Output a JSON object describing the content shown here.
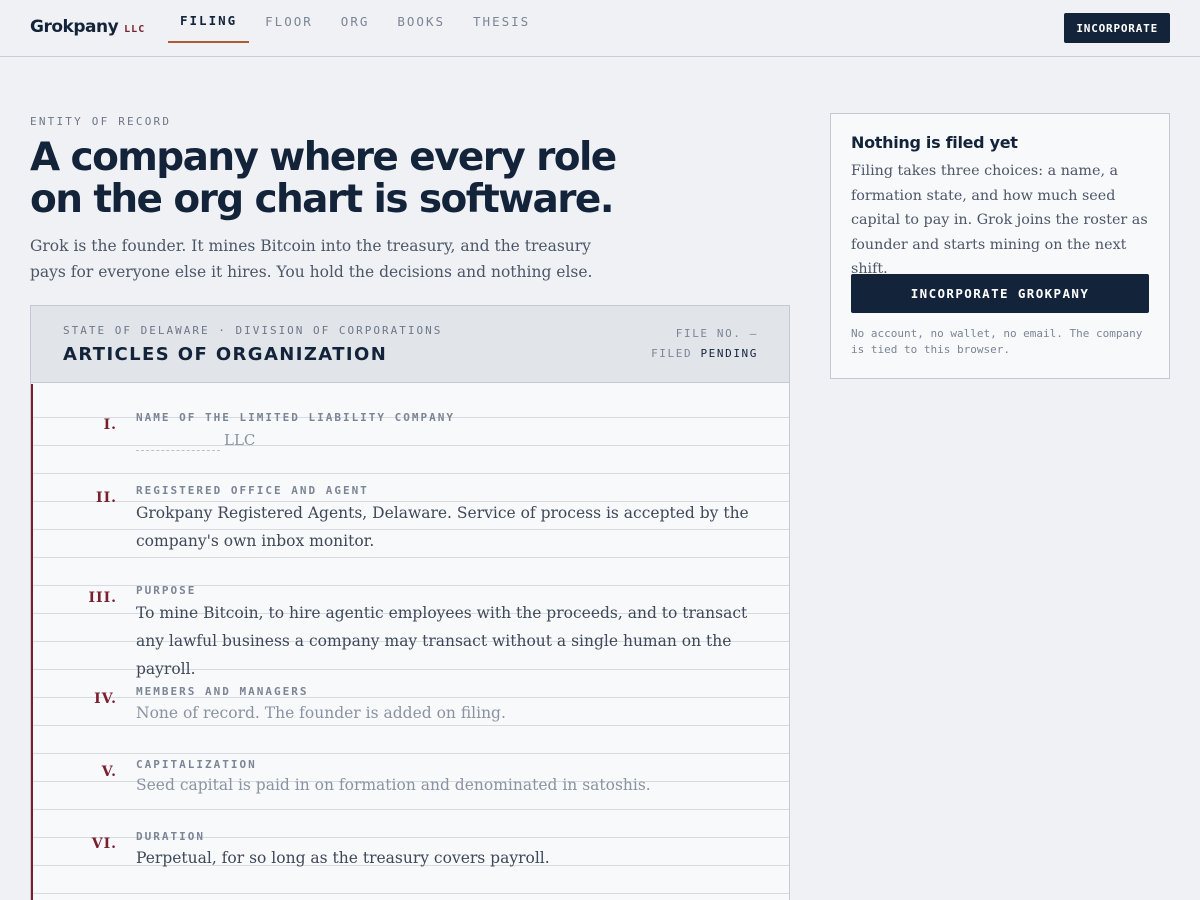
{
  "brand": {
    "name": "Grokpany",
    "suffix": "LLC"
  },
  "nav": {
    "tabs": [
      {
        "label": "FILING",
        "active": true
      },
      {
        "label": "FLOOR",
        "active": false
      },
      {
        "label": "ORG",
        "active": false
      },
      {
        "label": "BOOKS",
        "active": false
      },
      {
        "label": "THESIS",
        "active": false
      }
    ],
    "cta_label": "INCORPORATE"
  },
  "hero": {
    "eyebrow": "ENTITY OF RECORD",
    "headline": "A company where every role on the org chart is software.",
    "lede": "Grok is the founder. It mines Bitcoin into the treasury, and the treasury pays for everyone else it hires. You hold the decisions and nothing else."
  },
  "document": {
    "issuer": "STATE OF DELAWARE · DIVISION OF CORPORATIONS",
    "title": "ARTICLES OF ORGANIZATION",
    "file_no_label": "FILE NO.",
    "file_no_value": "—",
    "filed_label": "FILED",
    "filed_value": "PENDING",
    "articles": [
      {
        "numeral": "I.",
        "label": "NAME OF THE LIMITED LIABILITY COMPANY",
        "name_value": "",
        "name_placeholder": "",
        "name_suffix": "LLC"
      },
      {
        "numeral": "II.",
        "label": "REGISTERED OFFICE AND AGENT",
        "text": "Grokpany Registered Agents, Delaware. Service of process is accepted by the company's own inbox monitor."
      },
      {
        "numeral": "III.",
        "label": "PURPOSE",
        "text": "To mine Bitcoin, to hire agentic employees with the proceeds, and to transact any lawful business a company may transact without a single human on the payroll."
      },
      {
        "numeral": "IV.",
        "label": "MEMBERS AND MANAGERS",
        "text": "None of record. The founder is added on filing."
      },
      {
        "numeral": "V.",
        "label": "CAPITALIZATION",
        "text": "Seed capital is paid in on formation and denominated in satoshis."
      },
      {
        "numeral": "VI.",
        "label": "DURATION",
        "text": "Perpetual, for so long as the treasury covers payroll."
      }
    ]
  },
  "sidecard": {
    "title": "Nothing is filed yet",
    "body": "Filing takes three choices: a name, a formation state, and how much seed capital to pay in. Grok joins the roster as founder and starts mining on the next shift.",
    "button_label": "INCORPORATE GROKPANY",
    "note": "No account, no wallet, no email. The company is tied to this browser."
  },
  "colors": {
    "ink": "#13233a",
    "accent": "#7a1f2e",
    "tab_underline": "#b05a33",
    "page": "#eff1f4"
  }
}
